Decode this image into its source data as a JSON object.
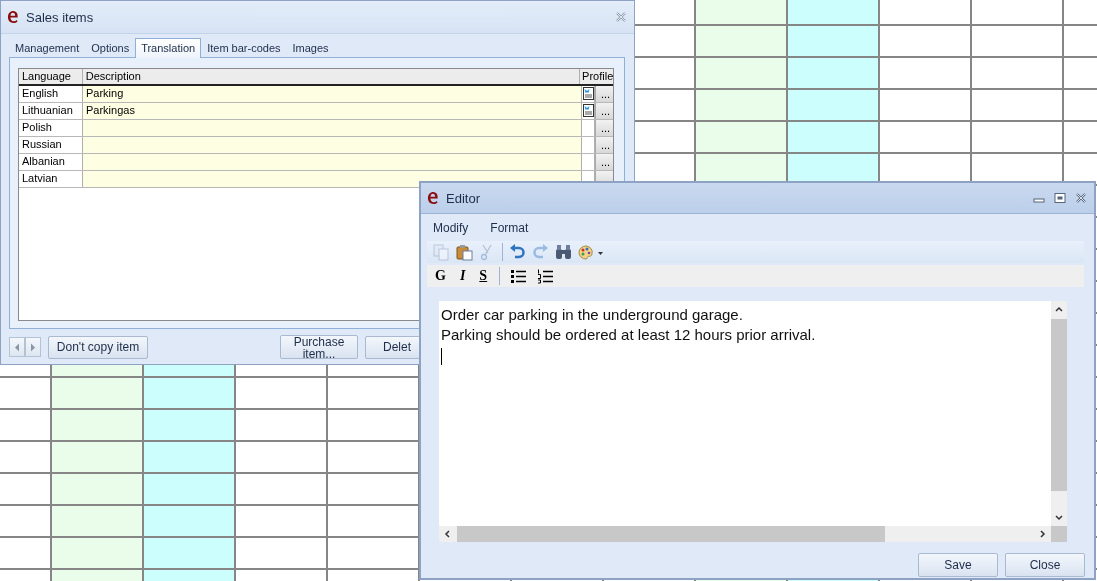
{
  "sales_window": {
    "title": "Sales items",
    "tabs": [
      {
        "label": "Management",
        "selected": false
      },
      {
        "label": "Options",
        "selected": false
      },
      {
        "label": "Translation",
        "selected": true
      },
      {
        "label": "Item bar-codes",
        "selected": false
      },
      {
        "label": "Images",
        "selected": false
      }
    ],
    "table": {
      "columns": [
        "Language",
        "Description",
        "Profile"
      ],
      "rows": [
        {
          "language": "English",
          "description": "Parking",
          "has_profile": true
        },
        {
          "language": "Lithuanian",
          "description": "Parkingas",
          "has_profile": true
        },
        {
          "language": "Polish",
          "description": "",
          "has_profile": false
        },
        {
          "language": "Russian",
          "description": "",
          "has_profile": false
        },
        {
          "language": "Albanian",
          "description": "",
          "has_profile": false
        },
        {
          "language": "Latvian",
          "description": "",
          "has_profile": false
        }
      ],
      "row_button": "..."
    },
    "buttons": [
      {
        "kind": "nav"
      },
      {
        "kind": "copy",
        "label": "Don't copy item"
      },
      {
        "kind": "purchase",
        "label": "Purchase item..."
      },
      {
        "kind": "delete",
        "label": "Delet"
      }
    ]
  },
  "editor": {
    "title": "Editor",
    "menu": [
      "Modify",
      "Format"
    ],
    "toolbar": [
      {
        "kind": "copy",
        "disabled": true
      },
      {
        "kind": "paste",
        "disabled": false
      },
      {
        "kind": "cut",
        "disabled": true
      },
      {
        "kind": "separator"
      },
      {
        "kind": "undo",
        "disabled": false
      },
      {
        "kind": "redo",
        "disabled": true
      },
      {
        "kind": "find",
        "disabled": false
      },
      {
        "kind": "palette",
        "disabled": false
      }
    ],
    "format_bar": [
      {
        "kind": "bold",
        "label": "G"
      },
      {
        "kind": "italic",
        "label": "I"
      },
      {
        "kind": "underline",
        "label": "S"
      },
      {
        "kind": "separator"
      },
      {
        "kind": "bullets"
      },
      {
        "kind": "numbering"
      }
    ],
    "text": [
      "Order car parking in the underground garage.",
      "Parking should be ordered at least 12 hours prior arrival."
    ],
    "buttons": [
      "Save",
      "Close"
    ]
  }
}
